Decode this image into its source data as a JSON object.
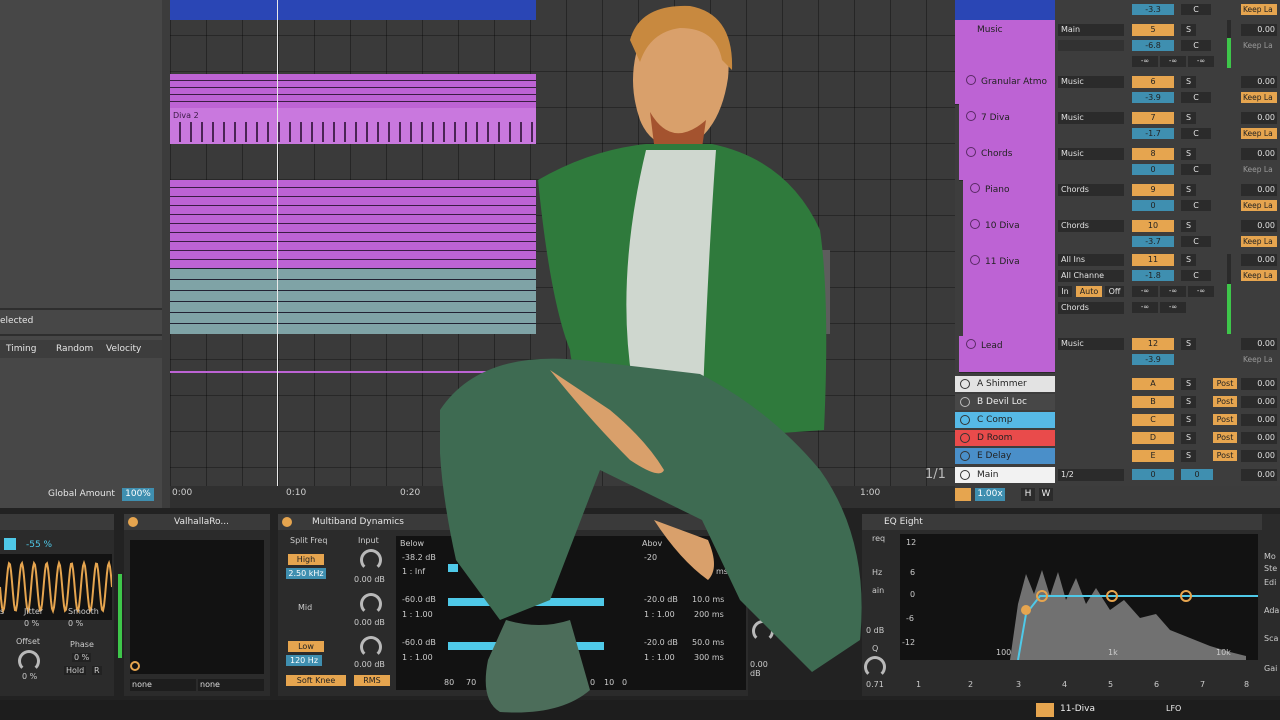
{
  "left_panel": {
    "selected_label": "elected",
    "tabs": [
      "Timing",
      "Random",
      "Velocity"
    ],
    "global_amount_label": "Global Amount",
    "global_amount_value": "100%"
  },
  "arrangement": {
    "clip_label": "Diva 2",
    "ruler": [
      "0:00",
      "0:10",
      "0:20",
      "1:00"
    ],
    "ratio": "1/1"
  },
  "mixer": {
    "tracks": [
      {
        "name": "Music",
        "route": "Main",
        "num": "5",
        "vol": "-6.8"
      },
      {
        "name": "Granular Atmo",
        "route": "Music",
        "num": "6",
        "vol": "-3.9"
      },
      {
        "name": "7 Diva",
        "route": "Music",
        "num": "7",
        "vol": "-1.7"
      },
      {
        "name": "Chords",
        "route": "Music",
        "num": "8",
        "vol": "0"
      },
      {
        "name": "Piano",
        "route": "Chords",
        "num": "9",
        "vol": "0"
      },
      {
        "name": "10 Diva",
        "route": "Chords",
        "num": "10",
        "vol": "-3.7"
      },
      {
        "name": "11 Diva",
        "route": "All Ins",
        "route2": "All Channe",
        "route3": "Chords",
        "num": "11",
        "vol": "-1.8"
      },
      {
        "name": "Lead",
        "route": "Music",
        "num": "12",
        "vol": "-3.9"
      }
    ],
    "top_vol": "-3.3",
    "monitor": {
      "in": "In",
      "auto": "Auto",
      "off": "Off"
    },
    "returns": [
      {
        "name": "A Shimmer",
        "letter": "A"
      },
      {
        "name": "B Devil Loc",
        "letter": "B"
      },
      {
        "name": "C Comp",
        "letter": "C"
      },
      {
        "name": "D Room",
        "letter": "D"
      },
      {
        "name": "E Delay",
        "letter": "E"
      },
      {
        "name": "Main",
        "letter": "0",
        "route": "1/2"
      }
    ],
    "out_value": "0.00",
    "keep_label": "Keep La",
    "post_label": "Post",
    "s_label": "S",
    "c_label": "C",
    "inf_label": "-∞",
    "zoom": "1.00x",
    "h_btn": "H",
    "w_btn": "W"
  },
  "devices": {
    "lfo": {
      "percent": "-55 %",
      "jitter_label": "Jitter",
      "jitter_value": "0 %",
      "smooth_label": "Smooth",
      "smooth_value": "0 %",
      "offset_label": "Offset",
      "offset_value": "0 %",
      "phase_label": "Phase",
      "phase_value": "0 %",
      "hold": "Hold",
      "r": "R",
      "s_label": "s"
    },
    "valhalla": {
      "title": "ValhallaRo...",
      "left_select": "none",
      "right_select": "none"
    },
    "multiband": {
      "title": "Multiband Dynamics",
      "split_freq": "Split Freq",
      "input": "Input",
      "high": "High",
      "high_freq": "2.50 kHz",
      "mid": "Mid",
      "low": "Low",
      "low_freq": "120 Hz",
      "in_gain": [
        "0.00 dB",
        "0.00 dB",
        "0.00 dB"
      ],
      "below": "Below",
      "below_rows": [
        [
          "-38.2 dB",
          "1 : Inf"
        ],
        [
          "-60.0 dB",
          "1 : 1.00"
        ],
        [
          "-60.0 dB",
          "1 : 1.00"
        ]
      ],
      "above": "Abov",
      "above_rows": [
        [
          "-20",
          "ms"
        ],
        [
          "-20.0 dB",
          "10.0 ms",
          "1 : 1.00",
          "200 ms"
        ],
        [
          "-20.0 dB",
          "50.0 ms",
          "1 : 1.00",
          "300 ms"
        ]
      ],
      "scale": [
        "80",
        "70",
        "0",
        "10",
        "0"
      ],
      "soft_knee": "Soft Knee",
      "rms": "RMS",
      "out_db": "0.00 dB"
    },
    "eq": {
      "title": "EQ Eight",
      "freq_partial": "req",
      "hz_partial": "Hz",
      "gain_partial": "ain",
      "db_partial": "0 dB",
      "q_label": "Q",
      "q_value": "0.71",
      "y_ticks": [
        "12",
        "6",
        "0",
        "-6",
        "-12"
      ],
      "x_ticks": [
        "100",
        "1k",
        "10k"
      ],
      "bands": [
        "1",
        "2",
        "3",
        "4",
        "5",
        "6",
        "7",
        "8"
      ]
    },
    "right_partial": {
      "mo": "Mo",
      "ste": "Ste",
      "edi": "Edi",
      "ada": "Ada",
      "sca": "Sca",
      "gai": "Gai"
    },
    "bottom": {
      "track": "11-Diva",
      "lfo": "LFO"
    }
  },
  "colors": {
    "purple": "#bd63d4",
    "blue": "#2a46b5",
    "teal": "#7fa3a6",
    "orange": "#e6a54f",
    "cyan": "#4fc9e8",
    "green": "#3ec64a",
    "red": "#e94b4b",
    "lightblue": "#56b9e6"
  }
}
